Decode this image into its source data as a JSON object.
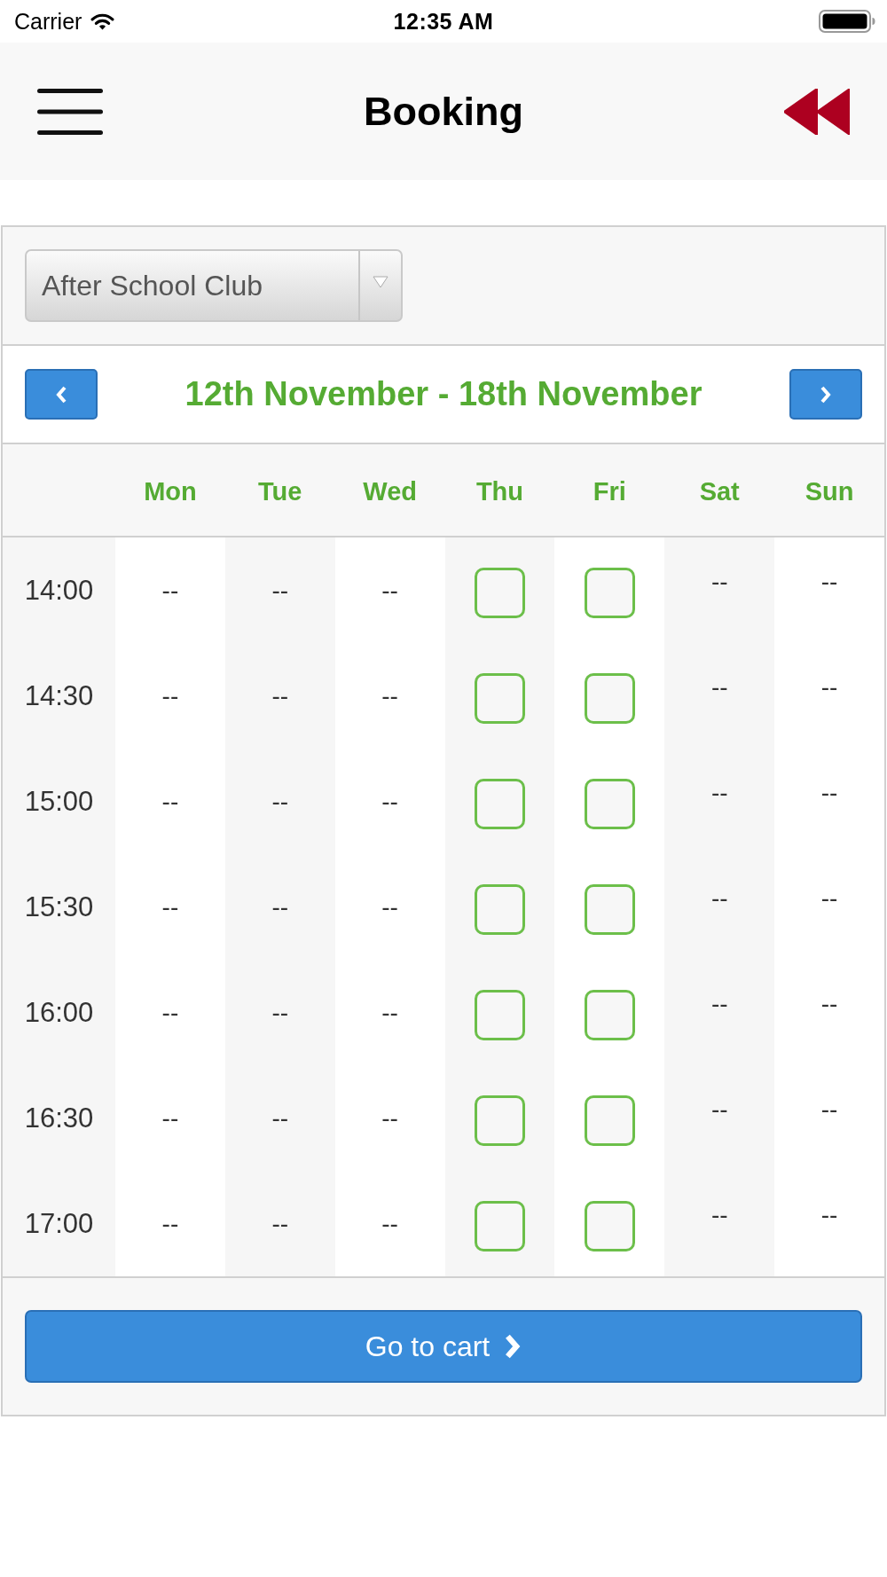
{
  "status_bar": {
    "carrier": "Carrier",
    "time": "12:35 AM"
  },
  "nav_bar": {
    "title": "Booking"
  },
  "activity_select": {
    "value": "After School Club"
  },
  "week": {
    "label": "12th November - 18th November"
  },
  "days": [
    "Mon",
    "Tue",
    "Wed",
    "Thu",
    "Fri",
    "Sat",
    "Sun"
  ],
  "slots": [
    {
      "time": "14:00",
      "cells": [
        {
          "kind": "text",
          "text": "--"
        },
        {
          "kind": "text",
          "text": "--"
        },
        {
          "kind": "text",
          "text": "--"
        },
        {
          "kind": "checkbox",
          "checked": false
        },
        {
          "kind": "checkbox",
          "checked": false
        },
        {
          "kind": "text",
          "text": "--"
        },
        {
          "kind": "text",
          "text": "--"
        }
      ]
    },
    {
      "time": "14:30",
      "cells": [
        {
          "kind": "text",
          "text": "--"
        },
        {
          "kind": "text",
          "text": "--"
        },
        {
          "kind": "text",
          "text": "--"
        },
        {
          "kind": "checkbox",
          "checked": false
        },
        {
          "kind": "checkbox",
          "checked": false
        },
        {
          "kind": "text",
          "text": "--"
        },
        {
          "kind": "text",
          "text": "--"
        }
      ]
    },
    {
      "time": "15:00",
      "cells": [
        {
          "kind": "text",
          "text": "--"
        },
        {
          "kind": "text",
          "text": "--"
        },
        {
          "kind": "text",
          "text": "--"
        },
        {
          "kind": "checkbox",
          "checked": false
        },
        {
          "kind": "checkbox",
          "checked": false
        },
        {
          "kind": "text",
          "text": "--"
        },
        {
          "kind": "text",
          "text": "--"
        }
      ]
    },
    {
      "time": "15:30",
      "cells": [
        {
          "kind": "text",
          "text": "--"
        },
        {
          "kind": "text",
          "text": "--"
        },
        {
          "kind": "text",
          "text": "--"
        },
        {
          "kind": "checkbox",
          "checked": false
        },
        {
          "kind": "checkbox",
          "checked": false
        },
        {
          "kind": "text",
          "text": "--"
        },
        {
          "kind": "text",
          "text": "--"
        }
      ]
    },
    {
      "time": "16:00",
      "cells": [
        {
          "kind": "text",
          "text": "--"
        },
        {
          "kind": "text",
          "text": "--"
        },
        {
          "kind": "text",
          "text": "--"
        },
        {
          "kind": "checkbox",
          "checked": false
        },
        {
          "kind": "checkbox",
          "checked": false
        },
        {
          "kind": "text",
          "text": "--"
        },
        {
          "kind": "text",
          "text": "--"
        }
      ]
    },
    {
      "time": "16:30",
      "cells": [
        {
          "kind": "text",
          "text": "--"
        },
        {
          "kind": "text",
          "text": "--"
        },
        {
          "kind": "text",
          "text": "--"
        },
        {
          "kind": "checkbox",
          "checked": false
        },
        {
          "kind": "checkbox",
          "checked": false
        },
        {
          "kind": "text",
          "text": "--"
        },
        {
          "kind": "text",
          "text": "--"
        }
      ]
    },
    {
      "time": "17:00",
      "cells": [
        {
          "kind": "text",
          "text": "--"
        },
        {
          "kind": "text",
          "text": "--"
        },
        {
          "kind": "text",
          "text": "--"
        },
        {
          "kind": "checkbox",
          "checked": false
        },
        {
          "kind": "checkbox",
          "checked": false
        },
        {
          "kind": "text",
          "text": "--"
        },
        {
          "kind": "text",
          "text": "--"
        }
      ]
    }
  ],
  "cart_button": {
    "label": "Go to cart"
  }
}
